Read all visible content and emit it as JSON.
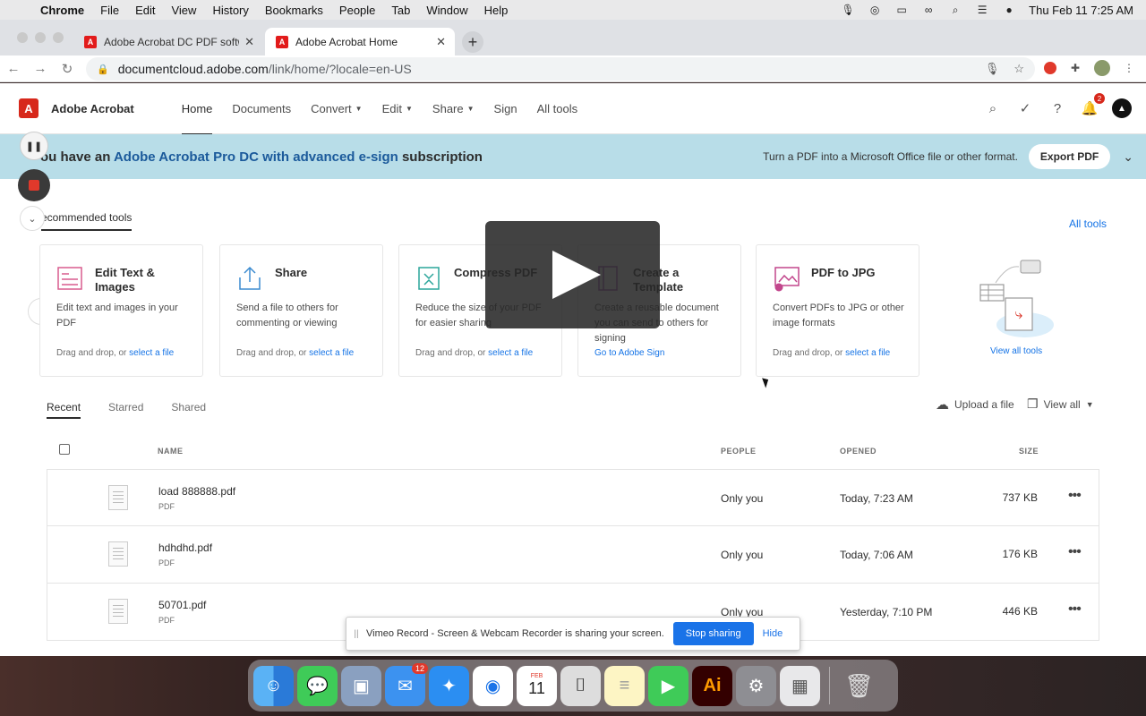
{
  "menubar": {
    "app": "Chrome",
    "items": [
      "File",
      "Edit",
      "View",
      "History",
      "Bookmarks",
      "People",
      "Tab",
      "Window",
      "Help"
    ],
    "clock": "Thu Feb 11  7:25 AM"
  },
  "tabs": [
    {
      "title": "Adobe Acrobat DC PDF softwa"
    },
    {
      "title": "Adobe Acrobat Home"
    }
  ],
  "address": {
    "host": "documentcloud.adobe.com",
    "path": "/link/home/?locale=en-US"
  },
  "app": {
    "brand": "Adobe Acrobat",
    "nav": [
      {
        "label": "Home"
      },
      {
        "label": "Documents"
      },
      {
        "label": "Convert"
      },
      {
        "label": "Edit"
      },
      {
        "label": "Share"
      },
      {
        "label": "Sign"
      },
      {
        "label": "All tools"
      }
    ],
    "notification_count": "2"
  },
  "banner": {
    "prefix": "ou have an ",
    "highlight": "Adobe Acrobat Pro DC with advanced e-sign",
    "suffix": " subscription",
    "promo": "Turn a PDF into a Microsoft Office file or other format.",
    "button": "Export PDF"
  },
  "recommended": {
    "title": "ecommended tools",
    "all_tools": "All tools",
    "view_all_tools": "View all tools",
    "cards": [
      {
        "title": "Edit Text & Images",
        "desc": "Edit text and images in your PDF",
        "foot": "Drag and drop, or ",
        "link": "select a file",
        "color": "#d95c8e"
      },
      {
        "title": "Share",
        "desc": "Send a file to others for commenting or viewing",
        "foot": "Drag and drop, or ",
        "link": "select a file",
        "color": "#3b8bd0"
      },
      {
        "title": "Compress PDF",
        "desc": "Reduce the size of your PDF for easier sharing",
        "foot": "Drag and drop, or ",
        "link": "select a file",
        "color": "#2aa59a"
      },
      {
        "title": "Create a Template",
        "desc": "Create a reusable document you can send to others for signing",
        "foot": "",
        "link": "Go to Adobe Sign",
        "color": "#a24ab3"
      },
      {
        "title": "PDF to JPG",
        "desc": "Convert PDFs to JPG or other image formats",
        "foot": "Drag and drop, or ",
        "link": "select a file",
        "color": "#c2468c"
      }
    ]
  },
  "files": {
    "tabs": [
      "Recent",
      "Starred",
      "Shared"
    ],
    "upload": "Upload a file",
    "view_all": "View all",
    "columns": {
      "name": "NAME",
      "people": "PEOPLE",
      "opened": "OPENED",
      "size": "SIZE"
    },
    "rows": [
      {
        "name": "load 888888.pdf",
        "type": "PDF",
        "people": "Only you",
        "opened": "Today, 7:23 AM",
        "size": "737 KB"
      },
      {
        "name": "hdhdhd.pdf",
        "type": "PDF",
        "people": "Only you",
        "opened": "Today, 7:06 AM",
        "size": "176 KB"
      },
      {
        "name": "50701.pdf",
        "type": "PDF",
        "people": "Only you",
        "opened": "Yesterday, 7:10 PM",
        "size": "446 KB"
      }
    ]
  },
  "share_bar": {
    "text": "Vimeo Record - Screen & Webcam Recorder is sharing your screen.",
    "stop": "Stop sharing",
    "hide": "Hide"
  },
  "dock": {
    "mail_badge": "12",
    "calendar_month": "FEB",
    "calendar_day": "11",
    "illustrator": "Ai"
  }
}
